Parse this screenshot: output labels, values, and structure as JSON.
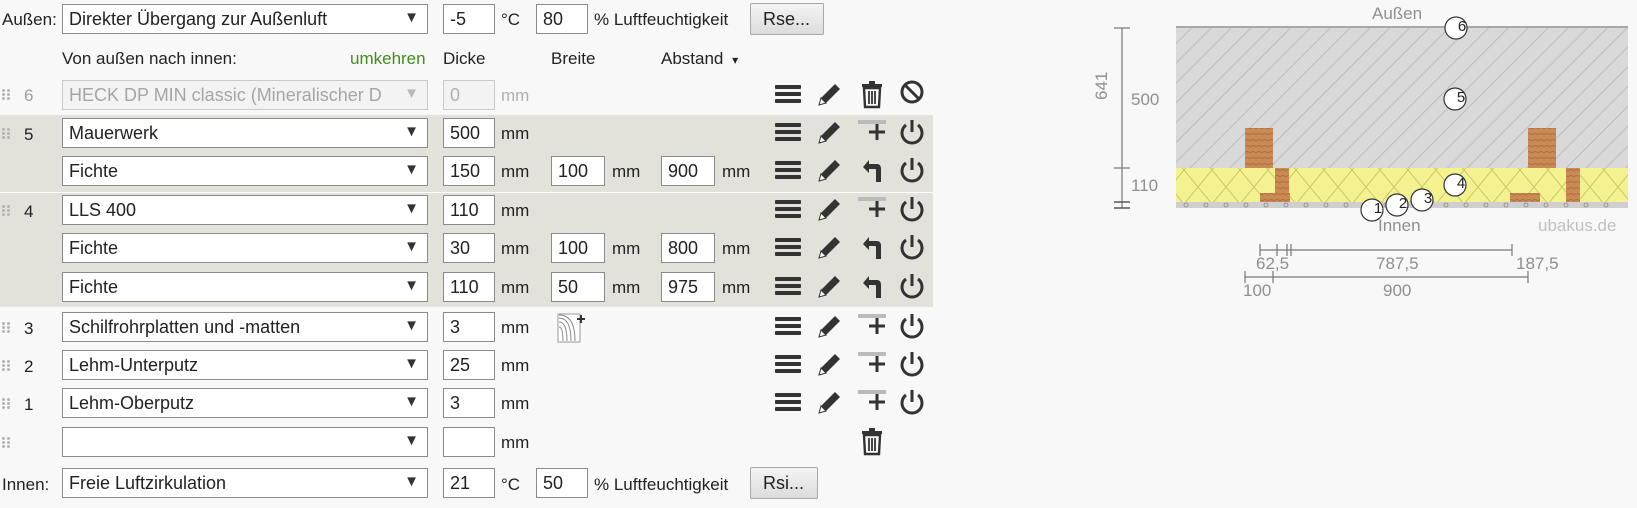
{
  "outside": {
    "label": "Außen:",
    "select": "Direkter Übergang zur Außenluft",
    "temp": "-5",
    "temp_unit": "°C",
    "humidity": "80",
    "humidity_label": "% Luftfeuchtigkeit",
    "button": "Rse..."
  },
  "header": {
    "direction": "Von außen nach innen:",
    "reverse": "umkehren",
    "col_dicke": "Dicke",
    "col_breite": "Breite",
    "col_abstand": "Abstand",
    "abstand_arrow": "▾"
  },
  "units": {
    "mm": "mm"
  },
  "layers": {
    "l6": {
      "num": "6",
      "material": "HECK DP MIN classic (Mineralischer D",
      "thickness": "0"
    },
    "l5": {
      "num": "5",
      "material": "Mauerwerk",
      "thickness": "500",
      "sub": {
        "material": "Fichte",
        "thickness": "150",
        "width": "100",
        "spacing": "900"
      }
    },
    "l4": {
      "num": "4",
      "material": "LLS 400",
      "thickness": "110",
      "sub1": {
        "material": "Fichte",
        "thickness": "30",
        "width": "100",
        "spacing": "800"
      },
      "sub2": {
        "material": "Fichte",
        "thickness": "110",
        "width": "50",
        "spacing": "975"
      }
    },
    "l3": {
      "num": "3",
      "material": "Schilfrohrplatten und -matten",
      "thickness": "3"
    },
    "l2": {
      "num": "2",
      "material": "Lehm-Unterputz",
      "thickness": "25"
    },
    "l1": {
      "num": "1",
      "material": "Lehm-Oberputz",
      "thickness": "3"
    },
    "empty": {
      "material": "",
      "thickness": ""
    }
  },
  "inside": {
    "label": "Innen:",
    "select": "Freie Luftzirkulation",
    "temp": "21",
    "temp_unit": "°C",
    "humidity": "50",
    "humidity_label": "% Luftfeuchtigkeit",
    "button": "Rsi..."
  },
  "diagram": {
    "top_label": "Außen",
    "bottom_label": "Innen",
    "brand": "ubakus.de",
    "total_thickness": "641",
    "dim_500": "500",
    "dim_110": "110",
    "markers": [
      "1",
      "2",
      "3",
      "4",
      "5",
      "6"
    ],
    "dim_row1": [
      "62,5",
      "787,5",
      "187,5"
    ],
    "dim_row2": [
      "100",
      "900"
    ],
    "colors": {
      "concrete": "#d9d9d9",
      "insulation": "#f2f08a",
      "wood": "#c98a56",
      "line": "#777777"
    }
  }
}
